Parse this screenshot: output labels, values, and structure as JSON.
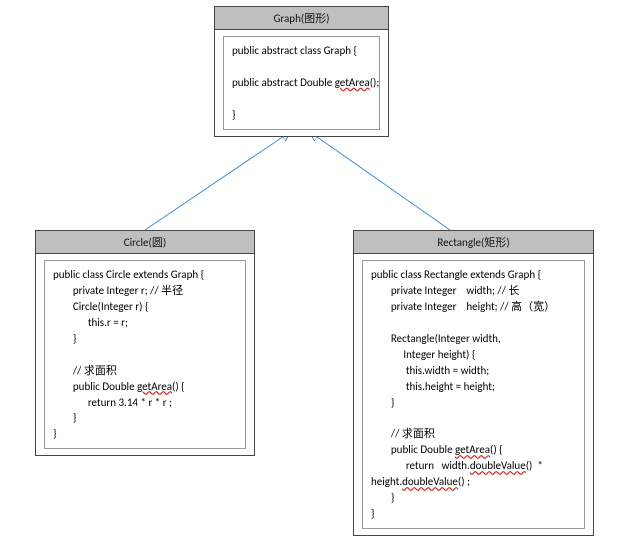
{
  "graph": {
    "title": "Graph(图形)",
    "line1": "public abstract class Graph {",
    "line2a": "public abstract Double ",
    "line2_squig": "getArea",
    "line2b": "();",
    "line3": "}"
  },
  "circle": {
    "title": "Circle(圆)",
    "l1": "public class Circle extends Graph {",
    "l2": "        private Integer r; // 半径",
    "l3": "        Circle(Integer r) {",
    "l4": "              this.r = r;",
    "l5": "        }",
    "l6": "",
    "l7": "        // 求面积",
    "l8a": "        public Double ",
    "l8_squig": "getArea",
    "l8b": "() {",
    "l9": "              return 3.14 * r * r ;",
    "l10": "        }",
    "l11": "}"
  },
  "rect": {
    "title": "Rectangle(矩形)",
    "l1": "public class Rectangle extends Graph {",
    "l2": "        private Integer    width; // 长",
    "l3": "        private Integer    height; // 高（宽）",
    "l4": "",
    "l5": "        Rectangle(Integer width,",
    "l6": "             Integer height) {",
    "l7": "              this.width = width;",
    "l8": "              this.height = height;",
    "l9": "        }",
    "l10": "",
    "l11": "        // 求面积",
    "l12a": "        public Double ",
    "l12_squig": "getArea",
    "l12b": "() {",
    "l13a": "              return   width.",
    "l13_squig": "doubleValue",
    "l13b": "()  *",
    "l14a": "height.",
    "l14_squig": "doubleValue",
    "l14b": "() ;",
    "l15": "        }",
    "l16": "}"
  }
}
